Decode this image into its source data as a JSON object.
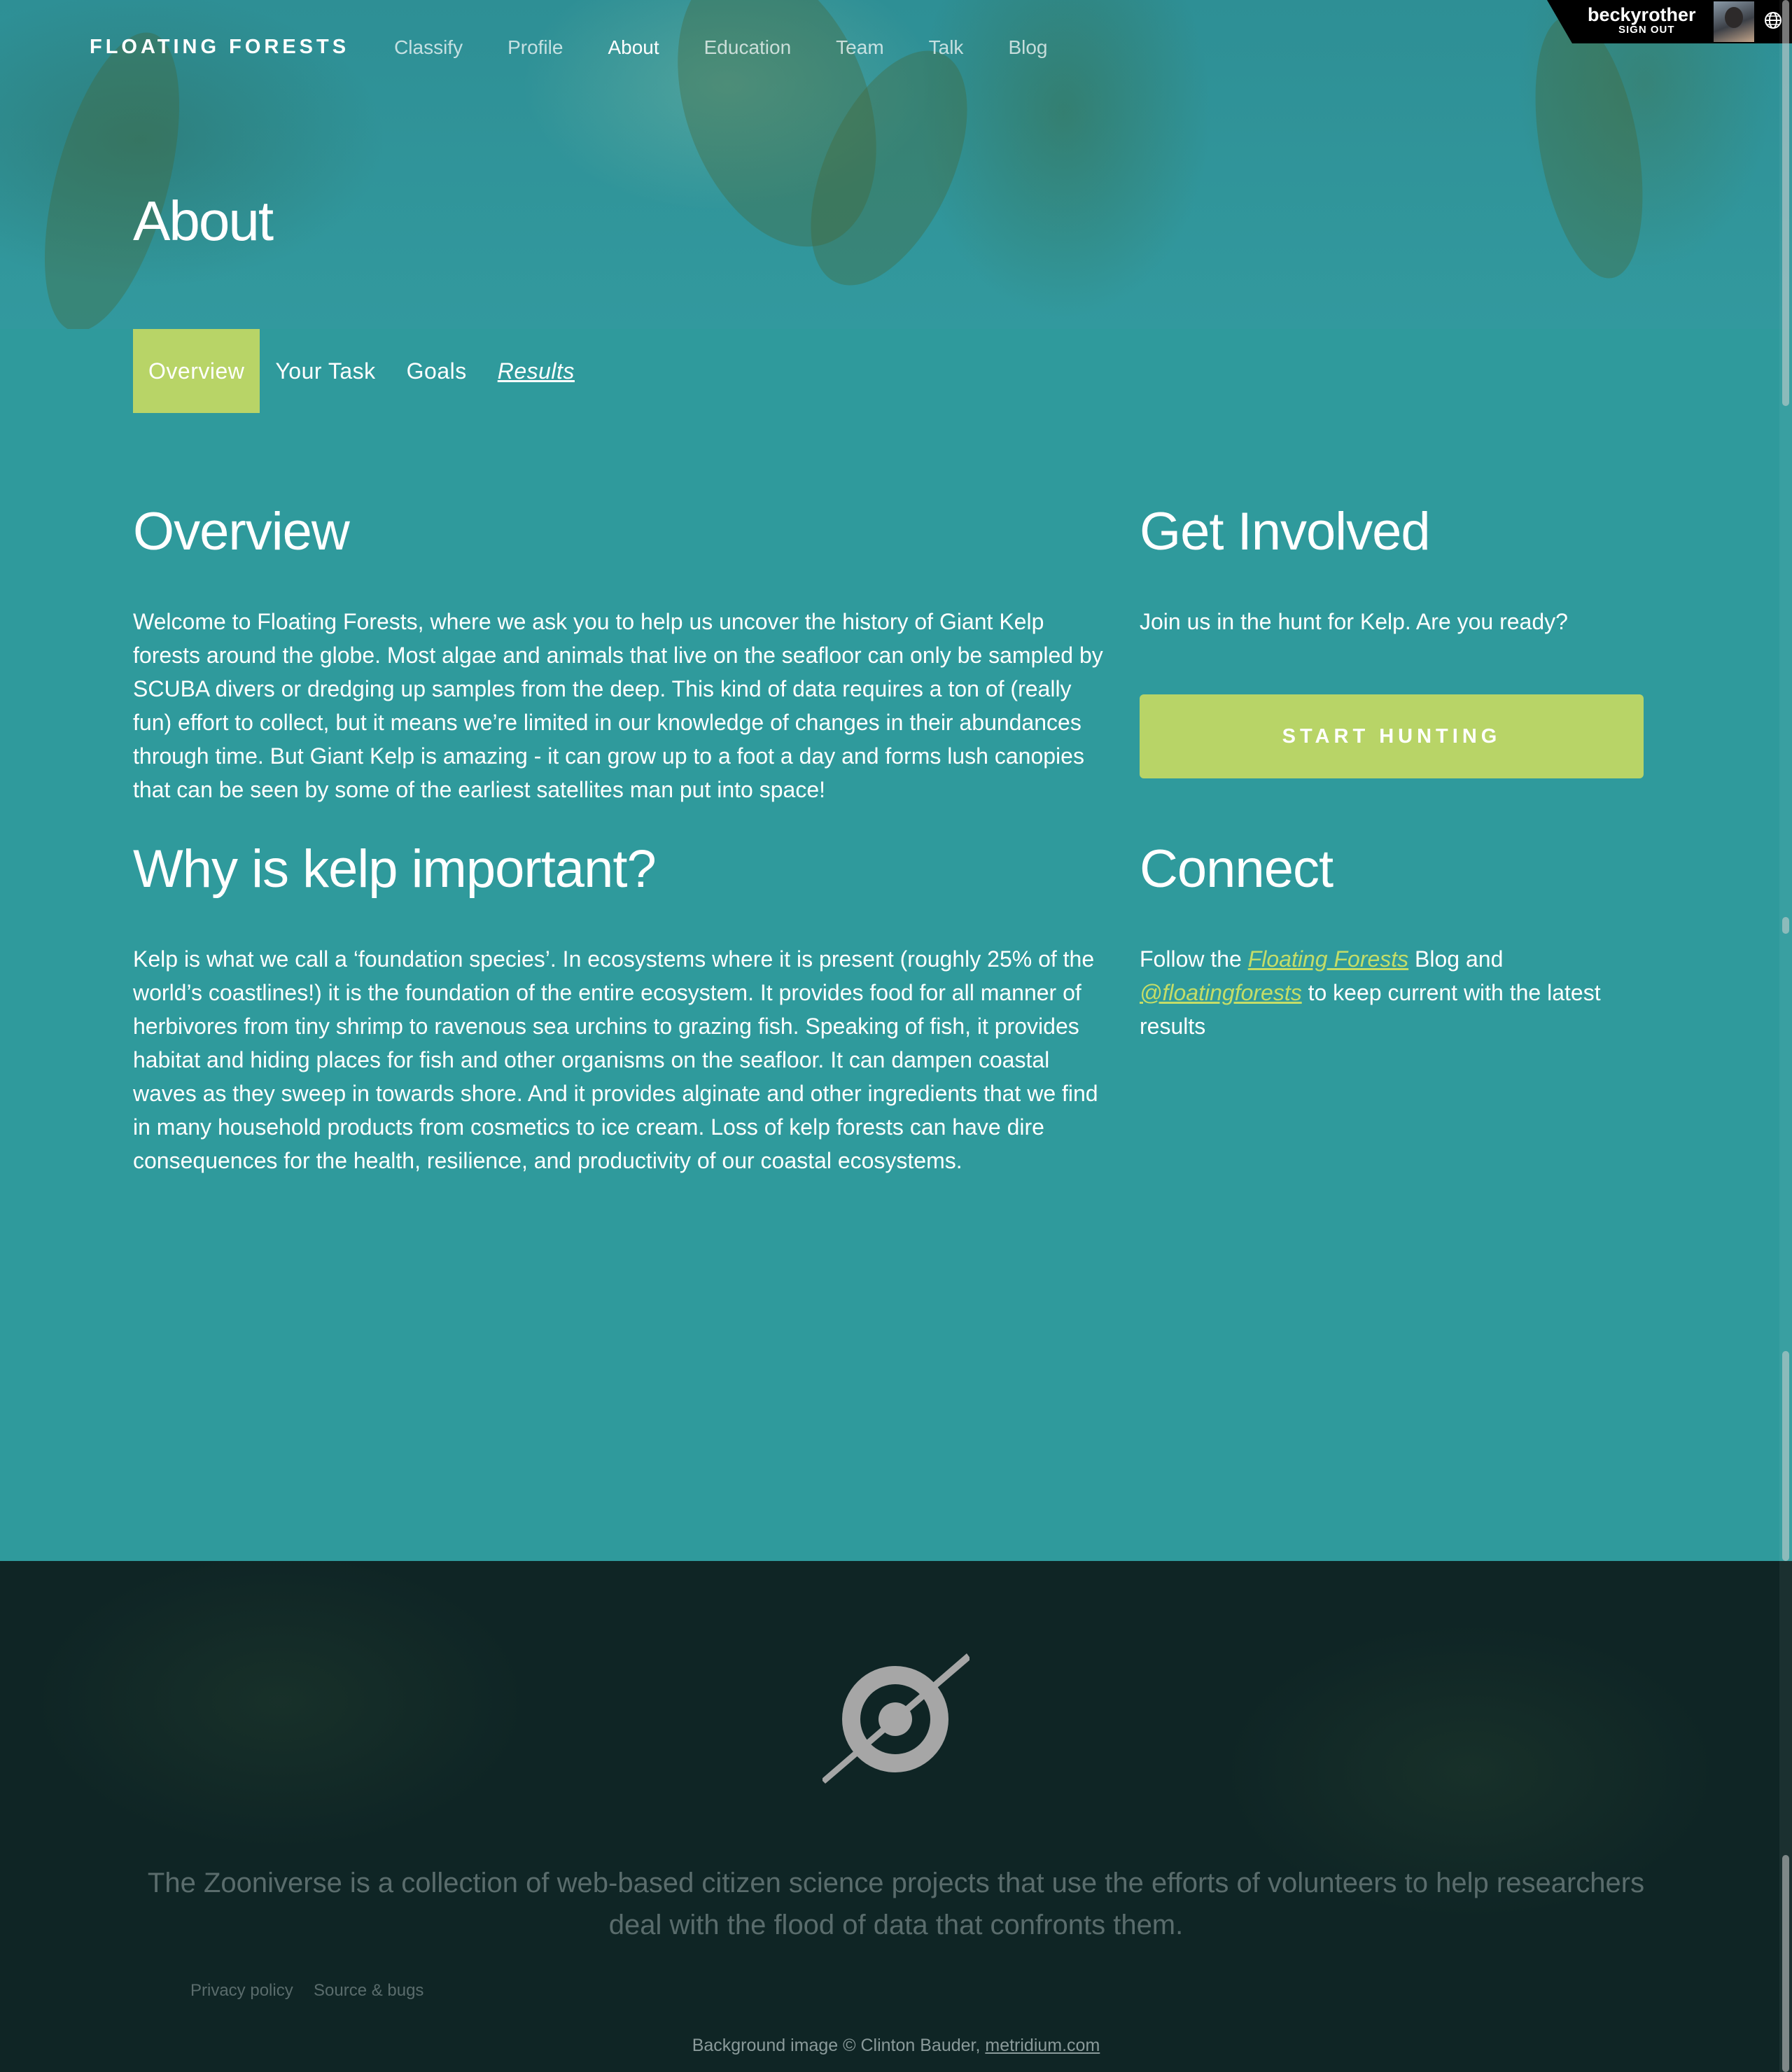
{
  "header": {
    "logo": "FLOATING FORESTS",
    "nav": [
      {
        "label": "Classify"
      },
      {
        "label": "Profile"
      },
      {
        "label": "About",
        "active": true
      },
      {
        "label": "Education"
      },
      {
        "label": "Team"
      },
      {
        "label": "Talk"
      },
      {
        "label": "Blog"
      }
    ],
    "user": {
      "name": "beckyrother",
      "sign_out": "SIGN OUT"
    },
    "language_icon": "globe-icon"
  },
  "hero": {
    "title": "About"
  },
  "tabs": [
    {
      "label": "Overview",
      "active": true
    },
    {
      "label": "Your Task"
    },
    {
      "label": "Goals"
    },
    {
      "label": "Results"
    }
  ],
  "overview": {
    "heading": "Overview",
    "text": "Welcome to Floating Forests, where we ask you to help us uncover the history of Giant Kelp forests around the globe. Most algae and animals that live on the seafloor can only be sampled by SCUBA divers or dredging up samples from the deep. This kind of data requires a ton of (really fun) effort to collect, but it means we’re limited in our knowledge of changes in their abundances through time. But Giant Kelp is amazing - it can grow up to a foot a day and forms lush canopies that can be seen by some of the earliest satellites man put into space!"
  },
  "why": {
    "heading": "Why is kelp important?",
    "text": "Kelp is what we call a ‘foundation species’. In ecosystems where it is present (roughly 25% of the world’s coastlines!) it is the foundation of the entire ecosystem. It provides food for all manner of herbivores from tiny shrimp to ravenous sea urchins to grazing fish. Speaking of fish, it provides habitat and hiding places for fish and other organisms on the seafloor. It can dampen coastal waves as they sweep in towards shore. And it provides alginate and other ingredients that we find in many household products from cosmetics to ice cream. Loss of kelp forests can have dire consequences for the health, resilience, and productivity of our coastal ecosystems."
  },
  "get_involved": {
    "heading": "Get Involved",
    "text": "Join us in the hunt for Kelp. Are you ready?",
    "button": "START HUNTING"
  },
  "connect": {
    "heading": "Connect",
    "pre": "Follow the ",
    "blog_link": "Floating Forests",
    "mid": " Blog and",
    "twitter_link": "@floatingforests",
    "post": " to keep current with the latest results"
  },
  "footer": {
    "logo_icon": "zooniverse-logo-icon",
    "text": "The Zooniverse is a collection of web-based citizen science projects that use the efforts of volunteers to help researchers deal with the flood of data that confronts them.",
    "privacy": "Privacy policy",
    "source": "Source & bugs",
    "credit_prefix": "Background image © Clinton Bauder, ",
    "credit_link": "metridium.com"
  },
  "colors": {
    "accent": "#b8d467",
    "link": "#c4dd68",
    "background": "#2f9a9c",
    "footer": "#0f2525"
  }
}
